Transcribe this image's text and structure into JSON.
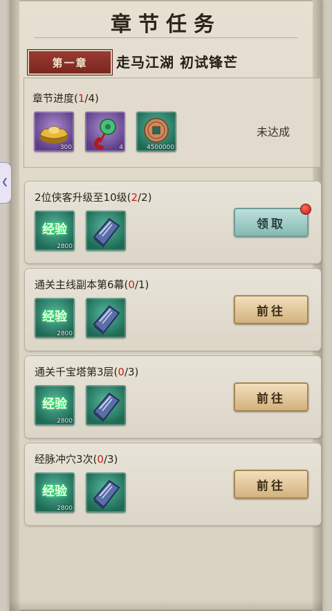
{
  "header": {
    "title": "章节任务"
  },
  "chapter": {
    "badge": "第一章",
    "name": "走马江湖 初试锋芒"
  },
  "progress": {
    "label_prefix": "章节进度(",
    "current": "1",
    "label_suffix": "/4)",
    "status": "未达成",
    "rewards": [
      {
        "icon": "gold-ingot-icon",
        "qty": "300"
      },
      {
        "icon": "jade-pendant-icon",
        "qty": "4"
      },
      {
        "icon": "copper-coin-icon",
        "qty": "4500000"
      }
    ]
  },
  "tasks": [
    {
      "label_prefix": "2位侠客升级至10级(",
      "current": "2",
      "label_suffix": "/2)",
      "button": "领取",
      "button_type": "claim",
      "has_alert": true,
      "rewards": [
        {
          "icon": "exp-icon",
          "text": "经验",
          "qty": "2800"
        },
        {
          "icon": "manual-book-icon",
          "qty": ""
        }
      ]
    },
    {
      "label_prefix": "通关主线副本第6幕(",
      "current": "0",
      "label_suffix": "/1)",
      "button": "前往",
      "button_type": "go",
      "has_alert": false,
      "rewards": [
        {
          "icon": "exp-icon",
          "text": "经验",
          "qty": "2800"
        },
        {
          "icon": "manual-book-icon",
          "qty": ""
        }
      ]
    },
    {
      "label_prefix": "通关千宝塔第3层(",
      "current": "0",
      "label_suffix": "/3)",
      "button": "前往",
      "button_type": "go",
      "has_alert": false,
      "rewards": [
        {
          "icon": "exp-icon",
          "text": "经验",
          "qty": "2800"
        },
        {
          "icon": "manual-book-icon",
          "qty": ""
        }
      ]
    },
    {
      "label_prefix": "经脉冲穴3次(",
      "current": "0",
      "label_suffix": "/3)",
      "button": "前往",
      "button_type": "go",
      "has_alert": false,
      "rewards": [
        {
          "icon": "exp-icon",
          "text": "经验",
          "qty": "2800"
        },
        {
          "icon": "manual-book-icon",
          "qty": ""
        }
      ]
    }
  ],
  "colors": {
    "highlight": "#c21d12",
    "claim_button": "#86b9b3",
    "go_button": "#d3b27e",
    "chapter_badge": "#7a2620"
  }
}
